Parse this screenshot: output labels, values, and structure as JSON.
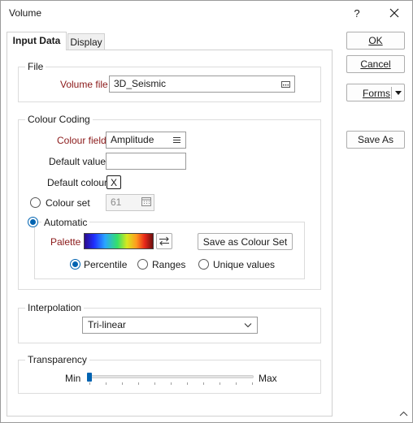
{
  "window": {
    "title": "Volume",
    "help_label": "?"
  },
  "tabs": [
    {
      "label": "Input Data"
    },
    {
      "label": "Display"
    }
  ],
  "file_group": {
    "legend": "File",
    "volume_file_label": "Volume file",
    "volume_file_value": "3D_Seismic"
  },
  "colour_group": {
    "legend": "Colour Coding",
    "colour_field_label": "Colour field",
    "colour_field_value": "Amplitude",
    "default_value_label": "Default value",
    "default_value": "",
    "default_colour_label": "Default colour",
    "default_colour_value": "X",
    "colour_set_label": "Colour set",
    "colour_set_value": "61",
    "automatic_label": "Automatic",
    "palette_label": "Palette",
    "save_colour_set_label": "Save as Colour Set",
    "percentile_label": "Percentile",
    "ranges_label": "Ranges",
    "unique_values_label": "Unique values"
  },
  "interpolation_group": {
    "legend": "Interpolation",
    "value": "Tri-linear"
  },
  "transparency_group": {
    "legend": "Transparency",
    "min_label": "Min",
    "max_label": "Max",
    "value": 0
  },
  "side_buttons": {
    "ok": "OK",
    "cancel": "Cancel",
    "forms": "Forms",
    "save_as": "Save As"
  },
  "colors": {
    "accent": "#0063b1",
    "required_label": "#8b1a1a"
  }
}
